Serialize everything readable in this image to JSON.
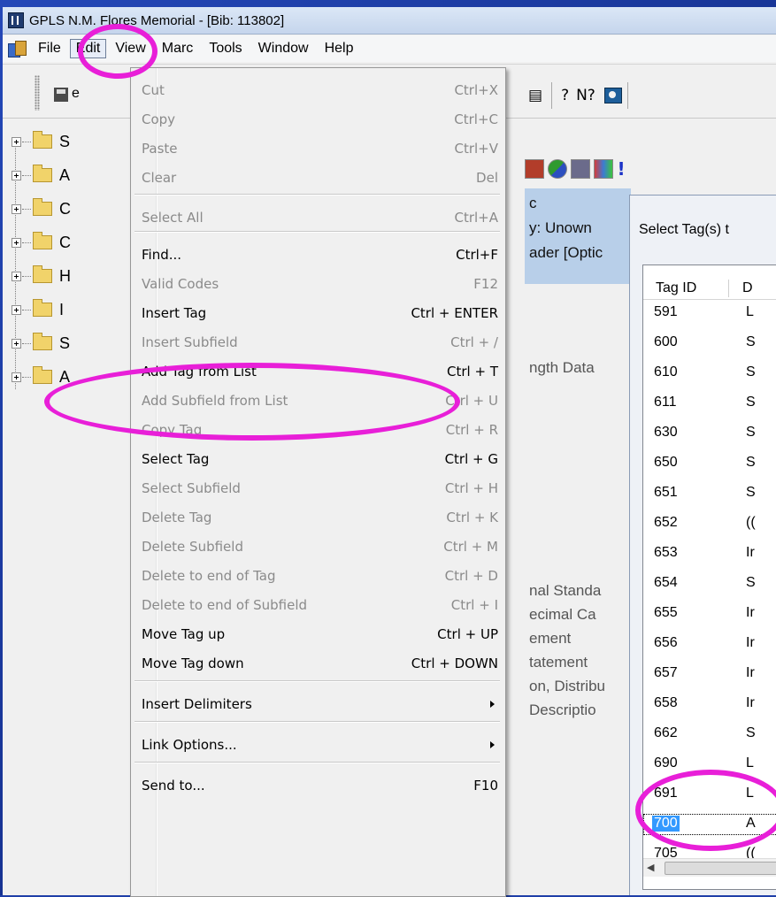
{
  "window": {
    "title": "GPLS N.M. Flores Memorial - [Bib: 113802]"
  },
  "menubar": {
    "items": [
      "File",
      "Edit",
      "View",
      "Marc",
      "Tools",
      "Window",
      "Help"
    ],
    "active": "Edit"
  },
  "toolbar": {
    "partial_label": "e",
    "right_glyphs": [
      "?",
      "N?"
    ]
  },
  "tree": {
    "items": [
      "S",
      "A",
      "C",
      "C",
      "H",
      "I",
      "S",
      "A"
    ]
  },
  "record_panel": {
    "lines": [
      "c",
      "y: Unown",
      "ader [Optic",
      "ngth Data",
      "nal Standa",
      "ecimal Ca",
      "ement",
      "tatement",
      "on, Distribu",
      "Descriptio"
    ]
  },
  "tool2": {
    "exclaim": "!"
  },
  "edit_menu": {
    "items": [
      {
        "label": "Cut",
        "shortcut": "Ctrl+X",
        "enabled": false
      },
      {
        "label": "Copy",
        "shortcut": "Ctrl+C",
        "enabled": false
      },
      {
        "label": "Paste",
        "shortcut": "Ctrl+V",
        "enabled": false
      },
      {
        "label": "Clear",
        "shortcut": "Del",
        "enabled": false
      },
      {
        "label": "Select All",
        "shortcut": "Ctrl+A",
        "enabled": false
      },
      {
        "label": "Find...",
        "shortcut": "Ctrl+F",
        "enabled": true
      },
      {
        "label": "Valid Codes",
        "shortcut": "F12",
        "enabled": false
      },
      {
        "label": "Insert Tag",
        "shortcut": "Ctrl + ENTER",
        "enabled": true
      },
      {
        "label": "Insert Subfield",
        "shortcut": "Ctrl + /",
        "enabled": false
      },
      {
        "label": "Add Tag from List",
        "shortcut": "Ctrl + T",
        "enabled": true
      },
      {
        "label": "Add Subfield from List",
        "shortcut": "Ctrl + U",
        "enabled": false
      },
      {
        "label": "Copy Tag",
        "shortcut": "Ctrl + R",
        "enabled": false
      },
      {
        "label": "Select Tag",
        "shortcut": "Ctrl + G",
        "enabled": true
      },
      {
        "label": "Select Subfield",
        "shortcut": "Ctrl + H",
        "enabled": false
      },
      {
        "label": "Delete Tag",
        "shortcut": "Ctrl + K",
        "enabled": false
      },
      {
        "label": "Delete Subfield",
        "shortcut": "Ctrl + M",
        "enabled": false
      },
      {
        "label": "Delete to end of Tag",
        "shortcut": "Ctrl + D",
        "enabled": false
      },
      {
        "label": "Delete to end of Subfield",
        "shortcut": "Ctrl + I",
        "enabled": false
      },
      {
        "label": "Move Tag up",
        "shortcut": "Ctrl + UP",
        "enabled": true
      },
      {
        "label": "Move Tag down",
        "shortcut": "Ctrl + DOWN",
        "enabled": true
      },
      {
        "label": "Insert Delimiters",
        "shortcut": "",
        "enabled": true
      },
      {
        "label": "Link Options...",
        "shortcut": "",
        "enabled": true
      },
      {
        "label": "Send to...",
        "shortcut": "F10",
        "enabled": true
      }
    ]
  },
  "dialog": {
    "title": "Select Tag(s) t",
    "columns": [
      "Tag ID",
      "D"
    ],
    "rows": [
      {
        "id": "591",
        "desc": "L"
      },
      {
        "id": "600",
        "desc": "S"
      },
      {
        "id": "610",
        "desc": "S"
      },
      {
        "id": "611",
        "desc": "S"
      },
      {
        "id": "630",
        "desc": "S"
      },
      {
        "id": "650",
        "desc": "S"
      },
      {
        "id": "651",
        "desc": "S"
      },
      {
        "id": "652",
        "desc": "(("
      },
      {
        "id": "653",
        "desc": "Ir"
      },
      {
        "id": "654",
        "desc": "S"
      },
      {
        "id": "655",
        "desc": "Ir"
      },
      {
        "id": "656",
        "desc": "Ir"
      },
      {
        "id": "657",
        "desc": "Ir"
      },
      {
        "id": "658",
        "desc": "Ir"
      },
      {
        "id": "662",
        "desc": "S"
      },
      {
        "id": "690",
        "desc": "L"
      },
      {
        "id": "691",
        "desc": "L"
      },
      {
        "id": "700",
        "desc": "A"
      },
      {
        "id": "705",
        "desc": "(("
      }
    ],
    "selected_id": "700"
  },
  "colors": {
    "annotation": "#e81fd8",
    "selection": "#3399ff",
    "slide_background": "#1f3fa8"
  }
}
